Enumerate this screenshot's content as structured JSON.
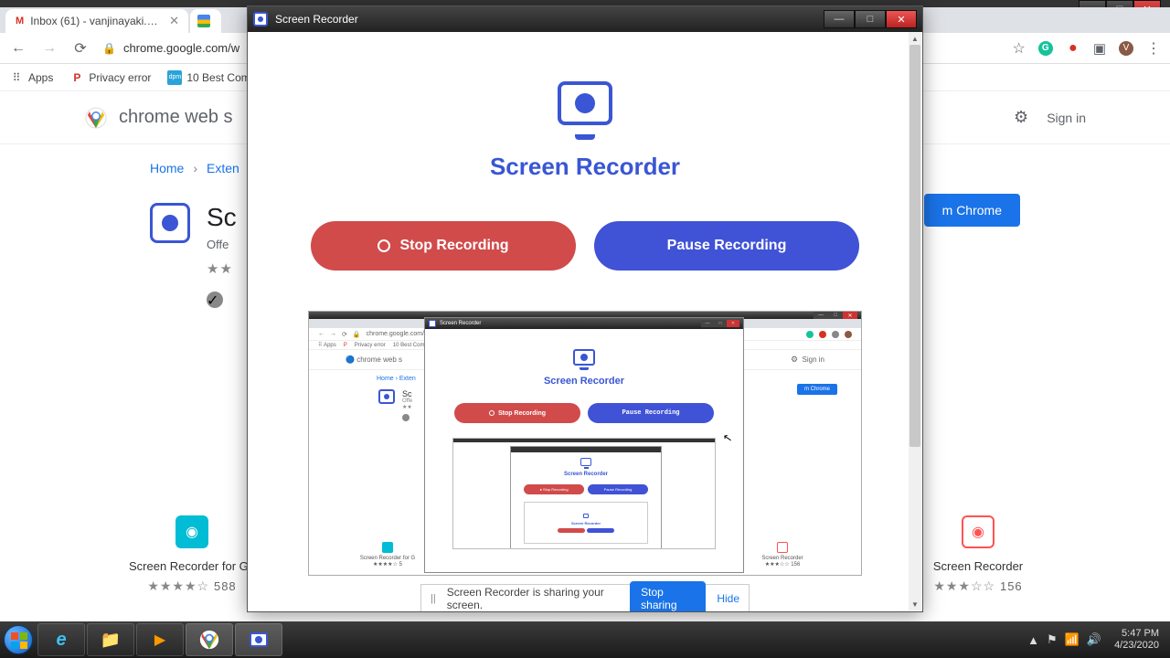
{
  "outer_window": {
    "min": "—",
    "max": "□",
    "close": "✕"
  },
  "chrome": {
    "tabs": [
      {
        "favicon": "M",
        "fav_color": "#d93025",
        "title": "Inbox (61) - vanjinayaki.s@csaca"
      },
      {
        "favicon": "",
        "fav_color": "#fff",
        "title": ""
      }
    ],
    "nav": {
      "back": "←",
      "forward": "→",
      "reload": "⟳"
    },
    "url": "chrome.google.com/w",
    "ext_icons": {
      "star": "☆",
      "grammarly": "G",
      "rec": "●",
      "cast": "▣",
      "avatar": "V",
      "menu": "⋮"
    },
    "bookmarks": [
      {
        "ico": "⠿",
        "label": "Apps"
      },
      {
        "ico": "P",
        "ico_color": "#d93025",
        "label": "Privacy error"
      },
      {
        "ico": "dpm",
        "ico_color": "#2aa3d8",
        "label": "10 Best Comm"
      }
    ]
  },
  "cws": {
    "title": "chrome web s",
    "gear": "⚙",
    "signin": "Sign in",
    "breadcrumb": {
      "home": "Home",
      "sep": "›",
      "ext": "Exten"
    },
    "hero": {
      "title": "Sc",
      "sub": "Offe",
      "stars": "★★",
      "add_btn": "m Chrome"
    },
    "related": [
      {
        "name": "Screen Recorder for Go",
        "stars": "★★★★☆",
        "count": "588",
        "color": "#00bcd4"
      },
      {
        "name": "Screen Recorder",
        "stars": "★★★☆☆",
        "count": "156",
        "color": "#ff5252"
      }
    ]
  },
  "recorder": {
    "win_title": "Screen Recorder",
    "win_min": "—",
    "win_max": "□",
    "win_close": "✕",
    "heading": "Screen Recorder",
    "stop": "Stop Recording",
    "pause": "Pause Recording"
  },
  "preview": {
    "url": "chrome.google.com/w",
    "cws_title": "chrome web s",
    "signin": "Sign in",
    "breadcrumb": "Home  ›  Exten",
    "hero_title": "Sc",
    "hero_sub": "Offe",
    "add_btn": "m Chrome",
    "rec_title": "Screen Recorder",
    "heading": "Screen Recorder",
    "stop": "Stop Recording",
    "pause": "Pause Recording",
    "rel1": "Screen Recorder for G",
    "rel1_stars": "★★★★☆  5",
    "rel2": "Screen Recorder",
    "rel2_stars": "★★★☆☆  156",
    "p2_heading": "Screen Recorder",
    "p2_stop": "● Stop Recording",
    "p2_pause": "Pause Recording"
  },
  "share": {
    "msg": "Screen Recorder is sharing your screen.",
    "stop": "Stop sharing",
    "hide": "Hide"
  },
  "taskbar": {
    "time": "5:47 PM",
    "date": "4/23/2020",
    "tray_up": "▲"
  }
}
